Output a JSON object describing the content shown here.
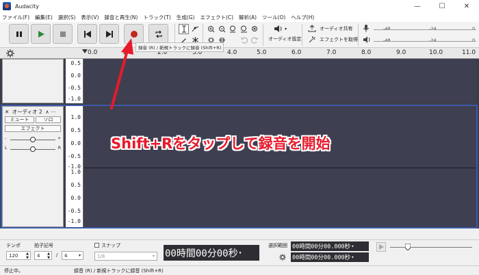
{
  "window": {
    "title": "Audacity",
    "minimize": "—",
    "maximize": "☐",
    "close": "✕"
  },
  "menu": [
    "ファイル(F)",
    "編集(E)",
    "選択(S)",
    "表示(V)",
    "録音と再生(N)",
    "トラック(T)",
    "生成(G)",
    "エフェクト(C)",
    "解析(A)",
    "ツール(O)",
    "ヘルプ(H)"
  ],
  "toolbar": {
    "audio_setup_label": "オーディオ設定",
    "share_audio_label": "オーディオ共有",
    "get_effects_label": "エフェクトを取得",
    "record_meter_scale": [
      "-48",
      "-24",
      "0"
    ],
    "play_meter_scale": [
      "-48",
      "-24",
      "0"
    ]
  },
  "tooltip": "録音 (R) / 新規トラックに録音 (Shift+R)",
  "ruler": {
    "ticks": [
      "0.0",
      "1.0",
      "2.0",
      "3.0",
      "4.0",
      "5.0",
      "6.0",
      "7.0",
      "8.0",
      "9.0",
      "10.0",
      "11.0"
    ]
  },
  "track1": {
    "scale": [
      "0.5",
      "0.0",
      "-0.5",
      "-1.0"
    ]
  },
  "track2": {
    "name": "オーディオ 2",
    "mute": "ミュート",
    "solo": "ソロ",
    "effects": "エフェクト",
    "pan_left": "L",
    "pan_right": "R",
    "scale": [
      "1.0",
      "0.5",
      "0.0",
      "-0.5",
      "-1.0",
      "1.0",
      "0.5",
      "0.0",
      "-0.5",
      "-1.0"
    ]
  },
  "overlay": "Shift+Rをタップして録音を開始",
  "bottom": {
    "tempo_label": "テンポ",
    "tempo_value": "120",
    "time_sig_label": "拍子記号",
    "time_sig_num": "4",
    "time_sig_sep": "/",
    "time_sig_den": "4",
    "snap_label": "スナップ",
    "snap_value": "1/8",
    "time_display": "00時間00分00秒",
    "selection_label": "選択範囲",
    "sel_start": "00時間00分00.000秒",
    "sel_end": "00時間00分00.000秒"
  },
  "status": {
    "state": "停止中。",
    "hint": "録音 (R) / 新規トラックに録音 (Shift+R)"
  },
  "colors": {
    "record": "#c0281e",
    "play": "#2e8b3a",
    "overlay": "#e8192c",
    "track_border": "#3b5ba8"
  }
}
